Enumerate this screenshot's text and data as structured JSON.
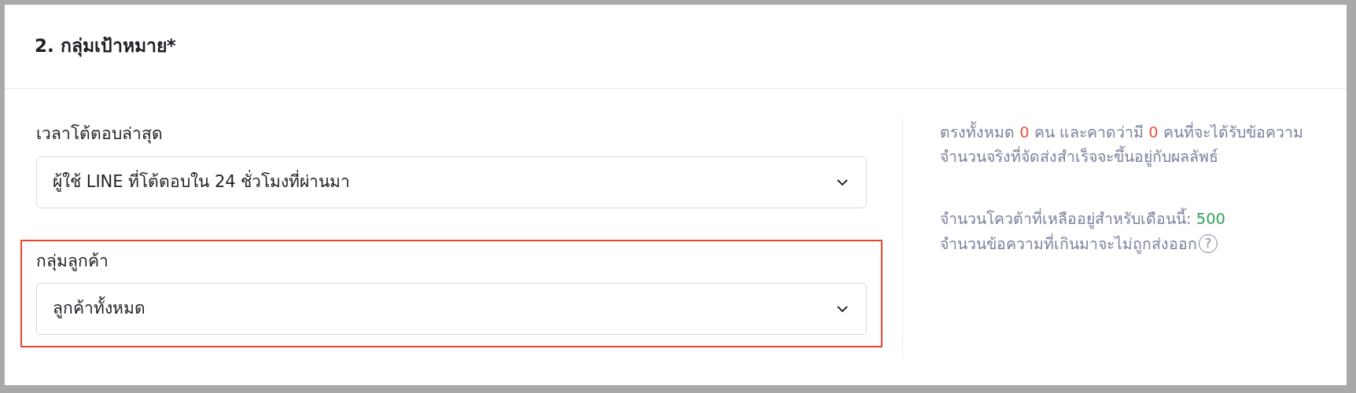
{
  "section": {
    "title": "2. กลุ่มเป้าหมาย*"
  },
  "fields": [
    {
      "label": "เวลาโต้ตอบล่าสุด",
      "value": "ผู้ใช้ LINE ที่โต้ตอบใน 24 ชั่วโมงที่ผ่านมา",
      "highlighted": false
    },
    {
      "label": "กลุ่มลูกค้า",
      "value": "ลูกค้าทั้งหมด",
      "highlighted": true
    }
  ],
  "summary": [
    {
      "kind": "text",
      "text": "ตรงทั้งหมด "
    },
    {
      "kind": "count",
      "text": "0"
    },
    {
      "kind": "text",
      "text": " คน และคาดว่ามี "
    },
    {
      "kind": "count",
      "text": "0"
    },
    {
      "kind": "text",
      "text": " คนที่จะได้รับข้อความจำนวนจริงที่จัดส่งสำเร็จจะขึ้นอยู่กับผลลัพธ์"
    }
  ],
  "quota": {
    "label": "จำนวนโควต้าที่เหลืออยู่สำหรับเดือนนี้:",
    "value": "500"
  },
  "note": "จำนวนข้อความที่เกินมาจะไม่ถูกส่งออก",
  "help_symbol": "?"
}
